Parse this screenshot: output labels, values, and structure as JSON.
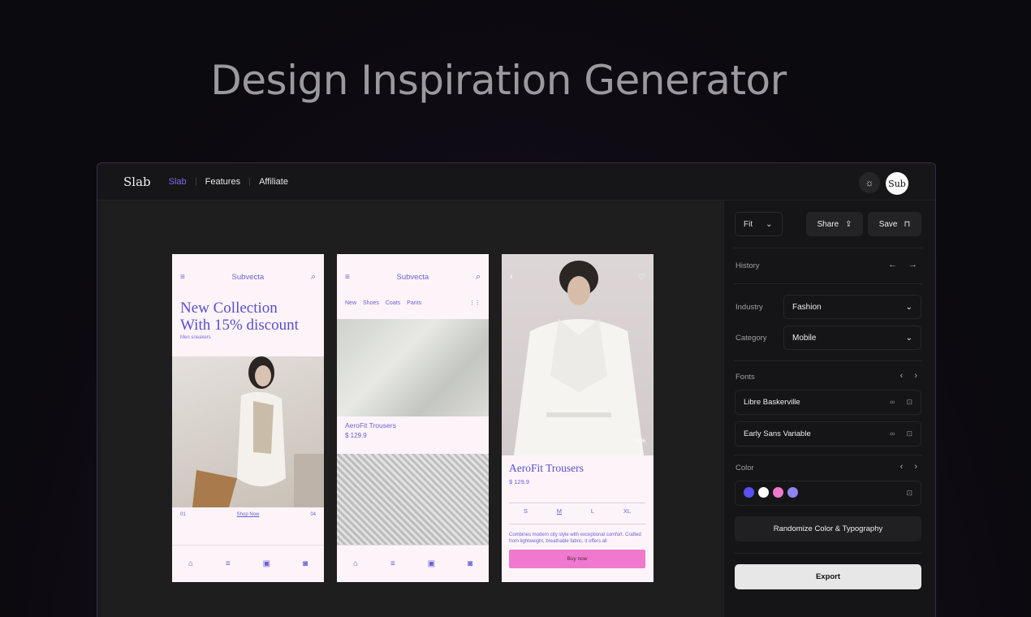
{
  "hero": {
    "title": "Design Inspiration Generator"
  },
  "topbar": {
    "logo": "Slab",
    "nav": [
      {
        "label": "Slab"
      },
      {
        "label": "Features"
      },
      {
        "label": "Affiliate"
      }
    ],
    "avatar_label": "Sub"
  },
  "side": {
    "fit": "Fit",
    "share": "Share",
    "save": "Save",
    "history": "History",
    "industry_label": "Industry",
    "industry_value": "Fashion",
    "category_label": "Category",
    "category_value": "Mobile",
    "fonts_label": "Fonts",
    "fonts": [
      "Libre Baskerville",
      "Early Sans Variable"
    ],
    "color_label": "Color",
    "colors": [
      "#5b4ff0",
      "#ffffff",
      "#ef79cc",
      "#8f86f0"
    ],
    "randomize": "Randomize Color & Typography",
    "export": "Export"
  },
  "phone1": {
    "brand": "Subvecta",
    "headline1": "New Collection",
    "headline2": "With 15% discount",
    "sub": "Men sneakers",
    "page_start": "01",
    "shop_now": "Shop Now",
    "page_end": "04"
  },
  "phone2": {
    "brand": "Subvecta",
    "tabs": [
      "New",
      "Shoes",
      "Coats",
      "Pants"
    ],
    "product_name": "AeroFit Trousers",
    "price": "$ 129.9"
  },
  "phone3": {
    "counter": "01/06",
    "product_name": "AeroFit Trousers",
    "price": "$ 129.9",
    "sizes": [
      "S",
      "M",
      "L",
      "XL"
    ],
    "description": "Combines modern city style with exceptional comfort. Crafted from lightweight, breathable fabric, it offers all",
    "buy": "Buy now"
  }
}
